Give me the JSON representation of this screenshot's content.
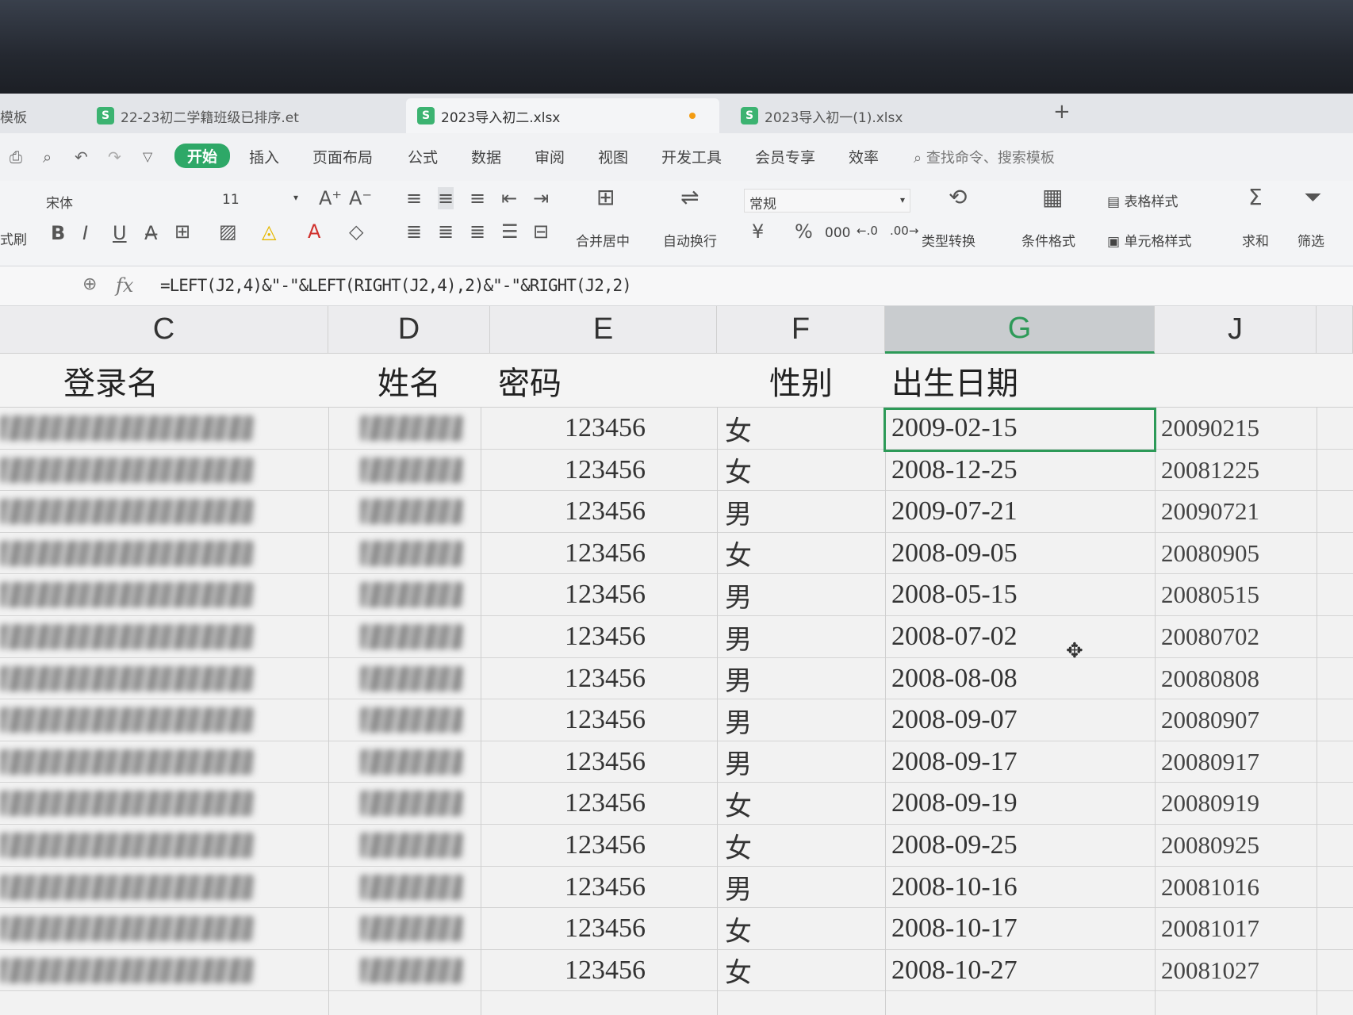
{
  "tabs": [
    {
      "label": "模板"
    },
    {
      "label": "22-23初二学籍班级已排序.et"
    },
    {
      "label": "2023导入初二.xlsx"
    },
    {
      "label": "2023导入初一(1).xlsx"
    }
  ],
  "menu": {
    "items": [
      "开始",
      "插入",
      "页面布局",
      "公式",
      "数据",
      "审阅",
      "视图",
      "开发工具",
      "会员专享",
      "效率"
    ],
    "search_placeholder": "查找命令、搜索模板"
  },
  "ribbon": {
    "font_name": "宋体",
    "font_size": "11",
    "number_format": "常规",
    "merge_label": "合并居中",
    "wrap_label": "自动换行",
    "type_convert_label": "类型转换",
    "cond_format_label": "条件格式",
    "table_style_label": "表格样式",
    "cell_style_label": "单元格样式",
    "sum_label": "求和",
    "filter_label": "筛选",
    "format_brush_label": "式刷",
    "currency_symbol": "¥",
    "percent_symbol": "%",
    "thousands_symbol": "000"
  },
  "formula_bar": {
    "fx_label": "fx",
    "formula": "=LEFT(J2,4)&\"-\"&LEFT(RIGHT(J2,4),2)&\"-\"&RIGHT(J2,2)"
  },
  "columns": [
    "C",
    "D",
    "E",
    "F",
    "G",
    "J"
  ],
  "header_row": {
    "login": "登录名",
    "name": "姓名",
    "password": "密码",
    "gender": "性别",
    "birth": "出生日期"
  },
  "rows": [
    {
      "password": "123456",
      "gender": "女",
      "birth": "2009-02-15",
      "raw": "20090215"
    },
    {
      "password": "123456",
      "gender": "女",
      "birth": "2008-12-25",
      "raw": "20081225"
    },
    {
      "password": "123456",
      "gender": "男",
      "birth": "2009-07-21",
      "raw": "20090721"
    },
    {
      "password": "123456",
      "gender": "女",
      "birth": "2008-09-05",
      "raw": "20080905"
    },
    {
      "password": "123456",
      "gender": "男",
      "birth": "2008-05-15",
      "raw": "20080515"
    },
    {
      "password": "123456",
      "gender": "男",
      "birth": "2008-07-02",
      "raw": "20080702"
    },
    {
      "password": "123456",
      "gender": "男",
      "birth": "2008-08-08",
      "raw": "20080808"
    },
    {
      "password": "123456",
      "gender": "男",
      "birth": "2008-09-07",
      "raw": "20080907"
    },
    {
      "password": "123456",
      "gender": "男",
      "birth": "2008-09-17",
      "raw": "20080917"
    },
    {
      "password": "123456",
      "gender": "女",
      "birth": "2008-09-19",
      "raw": "20080919"
    },
    {
      "password": "123456",
      "gender": "女",
      "birth": "2008-09-25",
      "raw": "20080925"
    },
    {
      "password": "123456",
      "gender": "男",
      "birth": "2008-10-16",
      "raw": "20081016"
    },
    {
      "password": "123456",
      "gender": "女",
      "birth": "2008-10-17",
      "raw": "20081017"
    },
    {
      "password": "123456",
      "gender": "女",
      "birth": "2008-10-27",
      "raw": "20081027"
    }
  ],
  "colors": {
    "accent": "#2d9a58"
  }
}
